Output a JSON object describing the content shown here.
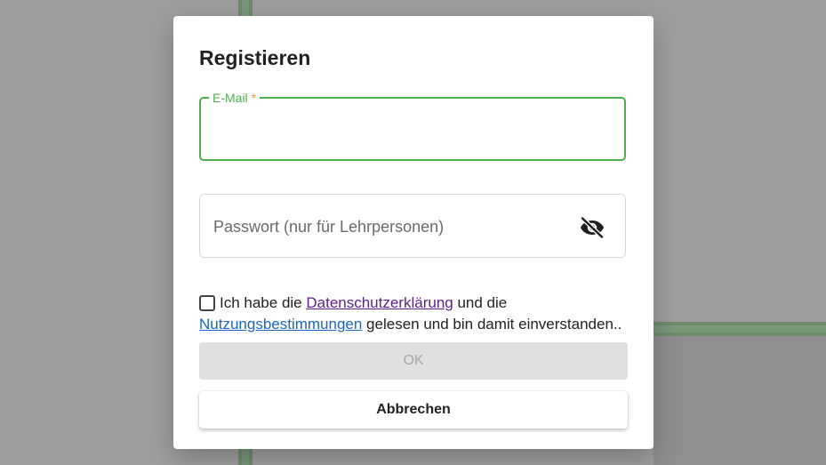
{
  "dialog": {
    "title": "Registieren",
    "email": {
      "label": "E-Mail",
      "required_marker": "*",
      "value": ""
    },
    "password": {
      "placeholder": "Passwort (nur für Lehrpersonen)",
      "value": "",
      "visibility_icon": "eye-off-icon"
    },
    "consent": {
      "checked": false,
      "text_1": "Ich habe die ",
      "privacy_link": "Datenschutzerklärung",
      "text_2": " und die ",
      "terms_link": "Nutzungsbestimmungen",
      "text_3": " gelesen und bin damit einverstanden.."
    },
    "ok_label": "OK",
    "cancel_label": "Abbrechen"
  },
  "colors": {
    "accent_green": "#4caf50",
    "required_orange": "#e8a23a",
    "privacy_link": "#5b1f8f",
    "terms_link": "#1a66c8"
  }
}
